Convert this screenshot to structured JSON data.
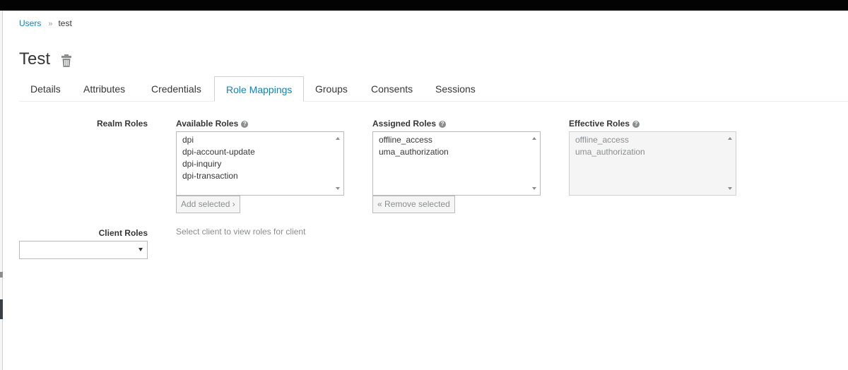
{
  "breadcrumb": {
    "parent": "Users",
    "separator": "»",
    "current": "test"
  },
  "page": {
    "title": "Test",
    "delete_icon": "trash-icon"
  },
  "tabs": [
    {
      "label": "Details"
    },
    {
      "label": "Attributes"
    },
    {
      "label": "Credentials"
    },
    {
      "label": "Role Mappings",
      "active": true
    },
    {
      "label": "Groups"
    },
    {
      "label": "Consents"
    },
    {
      "label": "Sessions"
    }
  ],
  "realm_roles": {
    "label": "Realm Roles",
    "available": {
      "label": "Available Roles",
      "items": [
        "dpi",
        "dpi-account-update",
        "dpi-inquiry",
        "dpi-transaction"
      ],
      "button": "Add selected"
    },
    "assigned": {
      "label": "Assigned Roles",
      "items": [
        "offline_access",
        "uma_authorization"
      ],
      "button": "Remove selected"
    },
    "effective": {
      "label": "Effective Roles",
      "items": [
        "offline_access",
        "uma_authorization"
      ]
    }
  },
  "client_roles": {
    "label": "Client Roles",
    "hint": "Select client to view roles for client",
    "select_value": ""
  },
  "colors": {
    "link": "#0088ce",
    "text": "#363636",
    "muted": "#8b8d8f"
  }
}
